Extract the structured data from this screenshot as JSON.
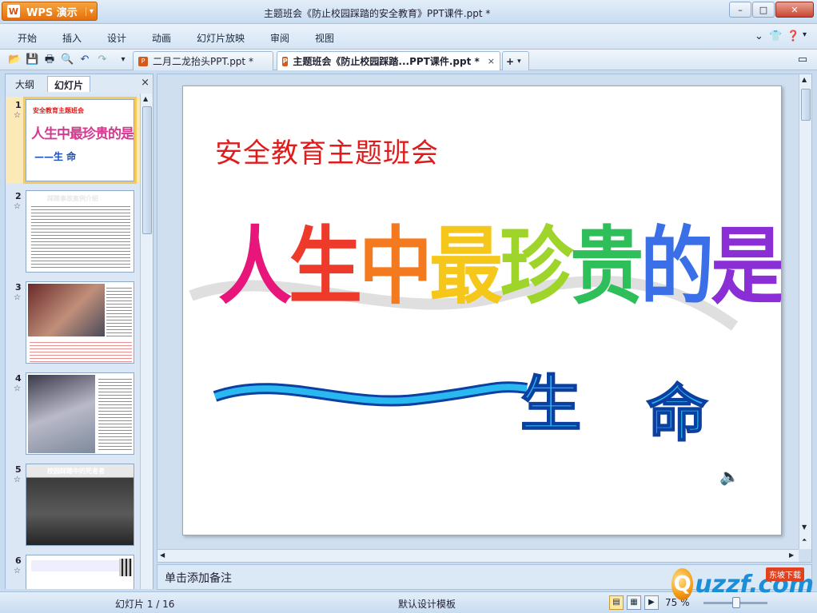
{
  "app": {
    "name": "WPS 演示",
    "logo_letter": "W",
    "window_title": "主题班会《防止校园踩踏的安全教育》PPT课件.ppt *"
  },
  "window_controls": {
    "minimize": "–",
    "maximize": "□",
    "close": "✕"
  },
  "menu": {
    "items": [
      "开始",
      "插入",
      "设计",
      "动画",
      "幻灯片放映",
      "审阅",
      "视图"
    ]
  },
  "toolbar": {
    "tabs": [
      {
        "label": "二月二龙抬头PPT.ppt *",
        "close": "×"
      },
      {
        "label": "主题班会《防止校园踩踏...PPT课件.ppt *",
        "close": "×"
      }
    ],
    "new_tab": "+"
  },
  "left_panel": {
    "tabs": [
      "大纲",
      "幻灯片"
    ],
    "close": "×",
    "thumbnails": [
      {
        "num": "1",
        "title": "安全教育主题班会",
        "big": "人生中最珍贵的是",
        "life": "——生 命"
      },
      {
        "num": "2",
        "title": "踩踏事故案例介绍"
      },
      {
        "num": "3",
        "title": ""
      },
      {
        "num": "4",
        "title": ""
      },
      {
        "num": "5",
        "title": "校园踩踏中的死者者"
      },
      {
        "num": "6",
        "title": ""
      }
    ]
  },
  "slide": {
    "subtitle": "安全教育主题班会",
    "big_chars": [
      "人",
      "生",
      "中",
      "最",
      "珍",
      "贵",
      "的",
      "是"
    ],
    "big_colors": [
      "#e8157a",
      "#ee3a2b",
      "#f37a1f",
      "#f5c71b",
      "#9fd42a",
      "#2fbf5a",
      "#3a6fe8",
      "#8a2fd6"
    ],
    "life_chars": [
      "生",
      "命"
    ]
  },
  "notes": {
    "placeholder": "单击添加备注"
  },
  "status": {
    "slide_counter": "幻灯片 1 / 16",
    "template": "默认设计模板",
    "zoom": "75 %"
  },
  "watermark": {
    "logo": "uzzf.com",
    "tag": "东坡下载"
  }
}
